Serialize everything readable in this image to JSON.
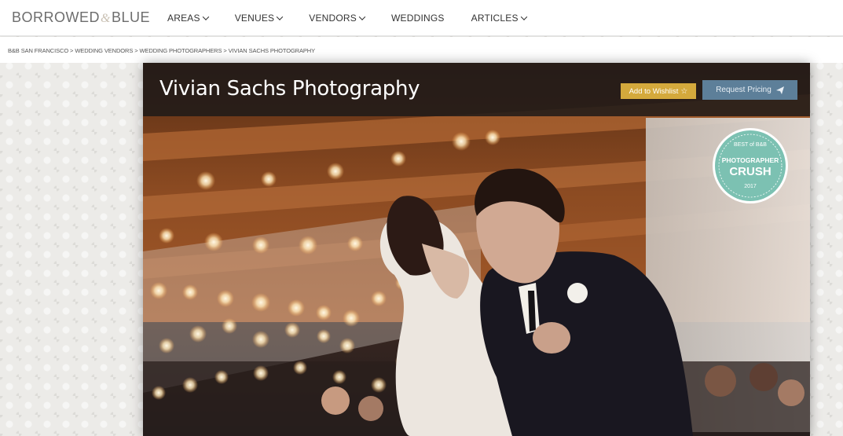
{
  "header": {
    "logo": {
      "part1": "BORROWED",
      "amp": "&",
      "part2": "BLUE"
    },
    "nav": [
      {
        "label": "AREAS",
        "dropdown": true
      },
      {
        "label": "VENUES",
        "dropdown": true
      },
      {
        "label": "VENDORS",
        "dropdown": true
      },
      {
        "label": "WEDDINGS",
        "dropdown": false
      },
      {
        "label": "ARTICLES",
        "dropdown": true
      }
    ]
  },
  "breadcrumb": {
    "items": [
      "B&B SAN FRANCISCO",
      "WEDDING VENDORS",
      "WEDDING PHOTOGRAPHERS",
      "VIVIAN SACHS PHOTOGRAPHY"
    ],
    "separator": " > "
  },
  "vendor": {
    "title": "Vivian Sachs Photography",
    "wishlist_label": "Add to Wishlist",
    "wishlist_icon": "star-outline-icon",
    "pricing_label": "Request Pricing",
    "pricing_icon": "paper-plane-icon"
  },
  "badge": {
    "top": "BEST of B&B",
    "line1": "PHOTOGRAPHER",
    "line2": "CRUSH",
    "year": "2017",
    "color": "#7cc1b2"
  },
  "colors": {
    "wishlist": "#d4a93c",
    "pricing": "#5d7f99",
    "titlebar": "#1e1a18"
  }
}
